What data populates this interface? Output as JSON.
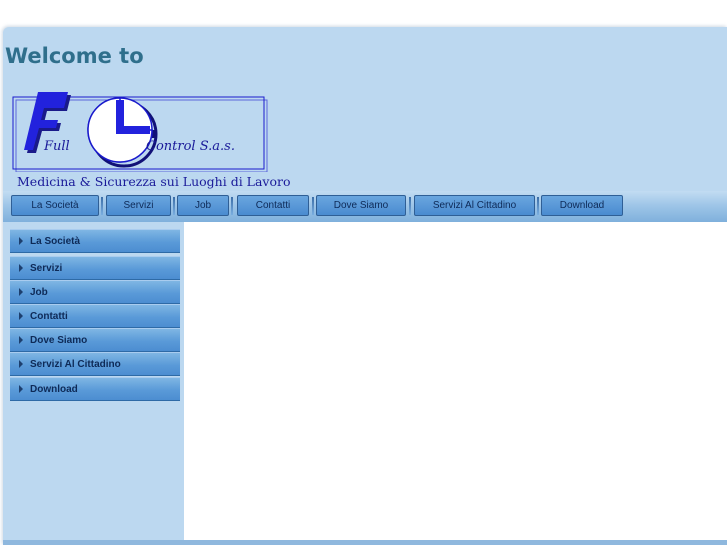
{
  "header": {
    "welcome": "Welcome to",
    "logo_word_left": "Full",
    "logo_word_right": "Control S.a.s.",
    "tagline": "Medicina & Sicurezza sui Luoghi di Lavoro"
  },
  "topnav": {
    "items": [
      {
        "label": "La Società"
      },
      {
        "label": "Servizi"
      },
      {
        "label": "Job"
      },
      {
        "label": "Contatti"
      },
      {
        "label": "Dove Siamo"
      },
      {
        "label": "Servizi Al Cittadino"
      },
      {
        "label": "Download"
      }
    ]
  },
  "sidebar": {
    "items": [
      {
        "label": "La Società"
      },
      {
        "label": "Servizi"
      },
      {
        "label": "Job"
      },
      {
        "label": "Contatti"
      },
      {
        "label": "Dove Siamo"
      },
      {
        "label": "Servizi Al Cittadino"
      },
      {
        "label": "Download"
      }
    ]
  },
  "colors": {
    "background": "#bcd8f0",
    "title": "#2f6f8c",
    "logo_blue": "#1a1acc",
    "nav_button": "#4a8bd0"
  }
}
